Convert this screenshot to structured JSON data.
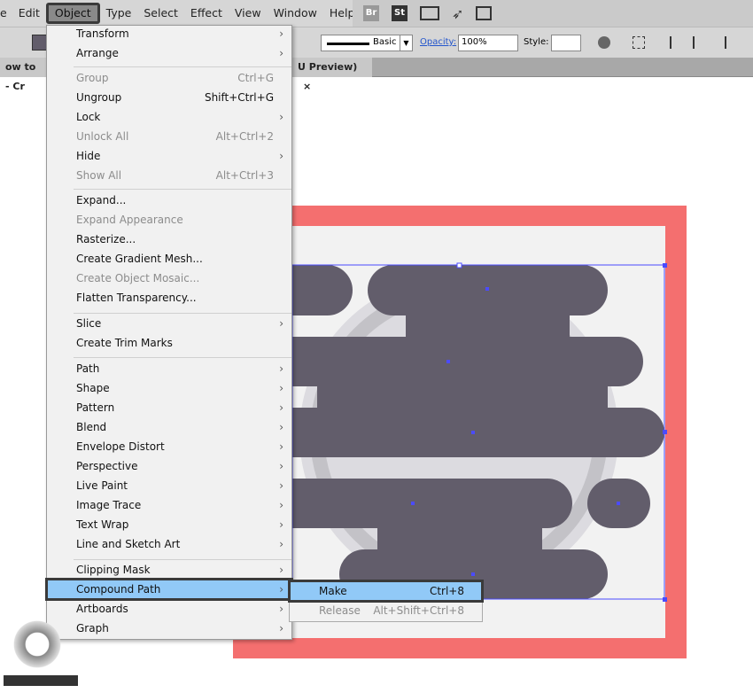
{
  "menubar": {
    "items": [
      "e",
      "Edit",
      "Object",
      "Type",
      "Select",
      "Effect",
      "View",
      "Window",
      "Help"
    ],
    "active": "Object"
  },
  "apps": {
    "br": "Br",
    "st": "St"
  },
  "control": {
    "stroke_style": "Basic",
    "opacity_label": "Opacity:",
    "opacity_value": "100%",
    "style_label": "Style:"
  },
  "tabs": {
    "left": "ow to - Cr",
    "right": "U Preview)",
    "close": "×"
  },
  "menu": {
    "items": [
      {
        "label": "Transform",
        "sub": true
      },
      {
        "label": "Arrange",
        "sub": true
      },
      {
        "label": "Group",
        "shortcut": "Ctrl+G",
        "disabled": true
      },
      {
        "label": "Ungroup",
        "shortcut": "Shift+Ctrl+G"
      },
      {
        "label": "Lock",
        "sub": true
      },
      {
        "label": "Unlock All",
        "shortcut": "Alt+Ctrl+2",
        "disabled": true
      },
      {
        "label": "Hide",
        "sub": true
      },
      {
        "label": "Show All",
        "shortcut": "Alt+Ctrl+3",
        "disabled": true
      },
      {
        "label": "Expand..."
      },
      {
        "label": "Expand Appearance",
        "disabled": true
      },
      {
        "label": "Rasterize..."
      },
      {
        "label": "Create Gradient Mesh..."
      },
      {
        "label": "Create Object Mosaic...",
        "disabled": true
      },
      {
        "label": "Flatten Transparency..."
      },
      {
        "label": "Slice",
        "sub": true
      },
      {
        "label": "Create Trim Marks"
      },
      {
        "label": "Path",
        "sub": true
      },
      {
        "label": "Shape",
        "sub": true
      },
      {
        "label": "Pattern",
        "sub": true
      },
      {
        "label": "Blend",
        "sub": true
      },
      {
        "label": "Envelope Distort",
        "sub": true
      },
      {
        "label": "Perspective",
        "sub": true
      },
      {
        "label": "Live Paint",
        "sub": true
      },
      {
        "label": "Image Trace",
        "sub": true
      },
      {
        "label": "Text Wrap",
        "sub": true
      },
      {
        "label": "Line and Sketch Art",
        "sub": true
      },
      {
        "label": "Clipping Mask",
        "sub": true
      },
      {
        "label": "Compound Path",
        "sub": true,
        "highlighted": true
      },
      {
        "label": "Artboards",
        "sub": true
      },
      {
        "label": "Graph",
        "sub": true
      }
    ]
  },
  "submenu": {
    "items": [
      {
        "label": "Make",
        "shortcut": "Ctrl+8",
        "highlighted": true
      },
      {
        "label": "Release",
        "shortcut": "Alt+Shift+Ctrl+8",
        "disabled": true
      }
    ]
  },
  "colors": {
    "artboard_border": "#f46f6f",
    "shape": "#625d6b",
    "selection": "#4b4bff",
    "highlight": "#91c9f7"
  }
}
